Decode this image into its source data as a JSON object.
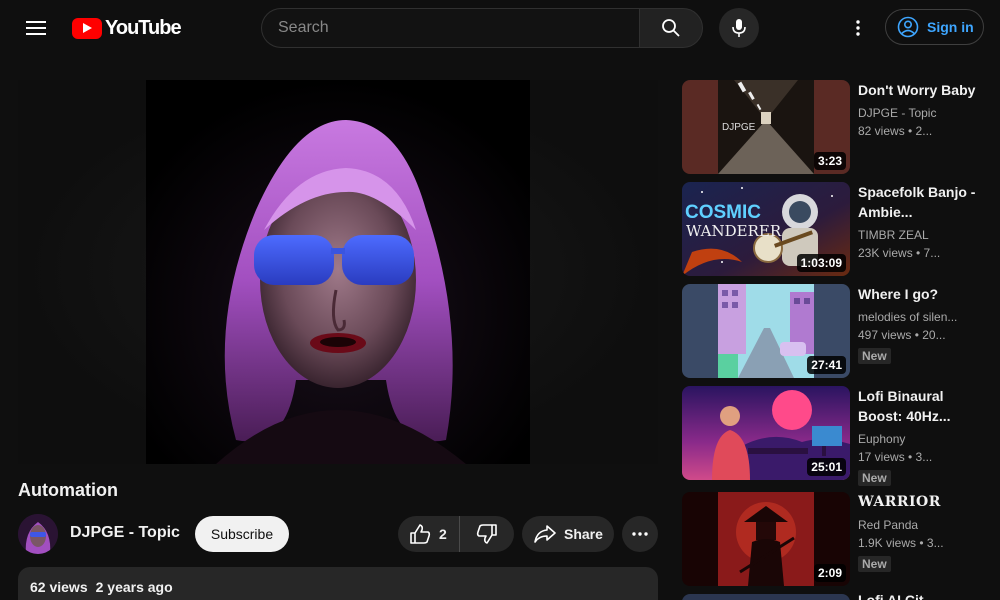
{
  "header": {
    "logo_text": "YouTube",
    "search_placeholder": "Search",
    "signin_label": "Sign in"
  },
  "video": {
    "title": "Automation",
    "channel": "DJPGE - Topic",
    "subscribe_label": "Subscribe",
    "likes": "2",
    "share_label": "Share",
    "views": "62 views",
    "age": "2 years ago"
  },
  "recommendations": [
    {
      "title": "Don't Worry Baby",
      "channel": "DJPGE - Topic",
      "meta": "82 views • 2...",
      "duration": "3:23",
      "badge": ""
    },
    {
      "title": "Spacefolk Banjo - Ambie...",
      "channel": "TIMBR ZEAL",
      "meta": "23K views • 7...",
      "duration": "1:03:09",
      "badge": "",
      "thumb_text_1": "COSMIC",
      "thumb_text_2": "WANDERER"
    },
    {
      "title": "Where I go?",
      "channel": "melodies of silen...",
      "meta": "497 views • 20...",
      "duration": "27:41",
      "badge": "New"
    },
    {
      "title": "Lofi Binaural Boost: 40Hz...",
      "channel": "Euphony",
      "meta": "17 views • 3...",
      "duration": "25:01",
      "badge": "New"
    },
    {
      "title": "WARRIOR",
      "channel": "Red Panda",
      "meta": "1.9K views • 3...",
      "duration": "2:09",
      "badge": "New"
    },
    {
      "title": "Lofi AI Cit..."
    }
  ],
  "thumb_text": {
    "djpge": "DJPGE"
  },
  "colors": {
    "accent_link": "#3ea6ff",
    "brand_red": "#ff0000",
    "chip_bg": "#272727"
  },
  "icons": [
    "menu-icon",
    "youtube-logo-icon",
    "search-icon",
    "mic-icon",
    "more-vert-icon",
    "account-icon",
    "thumb-up-icon",
    "thumb-down-icon",
    "share-icon",
    "more-horiz-icon"
  ]
}
